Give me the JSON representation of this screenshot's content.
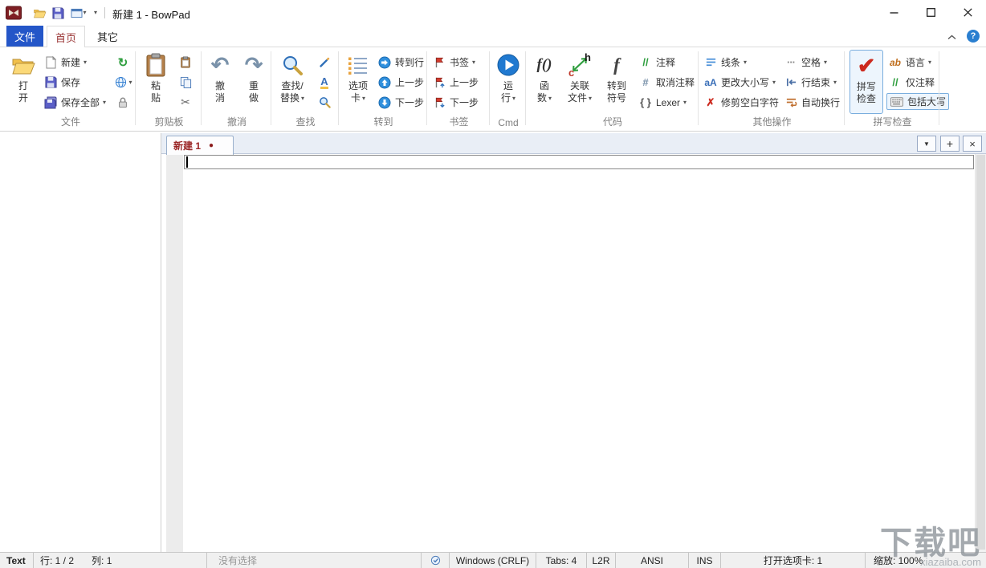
{
  "titlebar": {
    "title": "新建 1 - BowPad"
  },
  "glyphs": {
    "dropdown": "▾",
    "tab_dropdown": "▼",
    "plus": "+",
    "close_tab": "×",
    "reload": "↻",
    "undo": "↶",
    "redo": "↷",
    "scissors": "✂",
    "check": "✔",
    "cross": "✗",
    "dots": "···",
    "comment": "//",
    "uncomment": "#",
    "braces": "{ }",
    "fn": "f()",
    "fsym": "f",
    "aA": "aA",
    "ab": "ab",
    "A": "A",
    "help": "?",
    "hletter": "h",
    "cletter": "c"
  },
  "ribbon": {
    "tabs": [
      {
        "label": "文件"
      },
      {
        "label": "首页"
      },
      {
        "label": "其它"
      }
    ],
    "groups": [
      {
        "label": "文件",
        "open": {
          "l1": "打",
          "l2": "开"
        },
        "new": "新建",
        "save": "保存",
        "save_all": "保存全部"
      },
      {
        "label": "剪贴板",
        "paste": {
          "l1": "粘",
          "l2": "贴"
        }
      },
      {
        "label": "撤消",
        "undo": {
          "l1": "撤",
          "l2": "消"
        },
        "redo": {
          "l1": "重",
          "l2": "做"
        }
      },
      {
        "label": "查找",
        "find": {
          "l1": "查找/",
          "l2": "替换"
        }
      },
      {
        "label": "转到",
        "tab": {
          "l1": "选项",
          "l2": "卡"
        },
        "goto_line": "转到行",
        "prev": "上一步",
        "next": "下一步"
      },
      {
        "label": "书签",
        "bookmark": "书签",
        "prev": "上一步",
        "next": "下一步"
      },
      {
        "label": "Cmd",
        "run": {
          "l1": "运",
          "l2": "行"
        }
      },
      {
        "label": "代码",
        "func": {
          "l1": "函",
          "l2": "数"
        },
        "related": {
          "l1": "关联",
          "l2": "文件"
        },
        "symbol": {
          "l1": "转到",
          "l2": "符号"
        },
        "comment": "注释",
        "uncomment": "取消注释",
        "lexer": "Lexer"
      },
      {
        "label": "其他操作",
        "lines": "线条",
        "case": "更改大小写",
        "trim": "修剪空白字符",
        "spaces": "空格",
        "eol": "行结束",
        "wrap": "自动换行"
      },
      {
        "label": "拼写检查",
        "spell": {
          "l1": "拼写",
          "l2": "检查"
        },
        "language": "语言",
        "comments_only": "仅注释",
        "include_caps": "包括大写"
      }
    ]
  },
  "tabbar": {
    "tab_label": "新建 1",
    "modified_dot": "●"
  },
  "statusbar": {
    "doctype": "Text",
    "line_col": "行: 1 / 2",
    "col": "列: 1",
    "selection": "没有选择",
    "eol": "Windows (CRLF)",
    "tabs": "Tabs: 4",
    "direction": "L2R",
    "encoding": "ANSI",
    "insert": "INS",
    "open_tabs": "打开选项卡: 1",
    "zoom": "缩放: 100%"
  },
  "watermark": {
    "title": "下载吧",
    "url": "xiazaiba.com"
  }
}
